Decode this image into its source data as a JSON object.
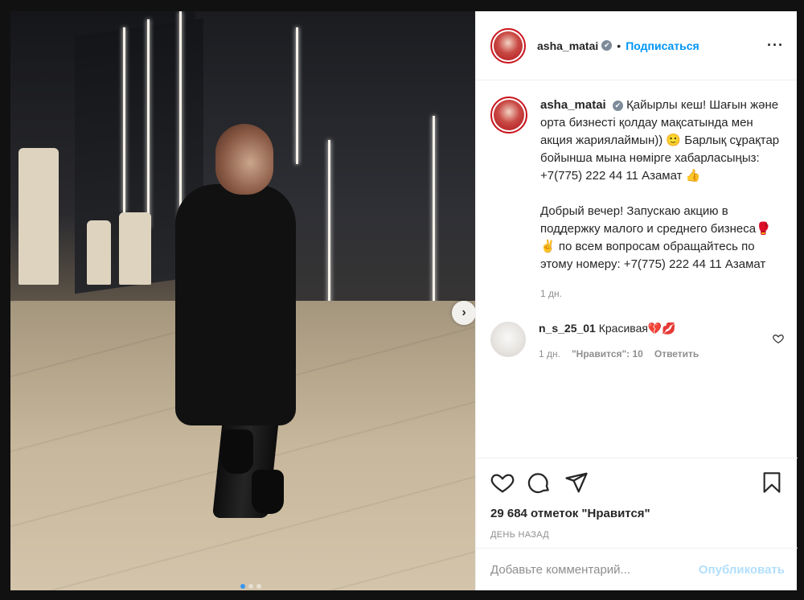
{
  "post": {
    "username": "asha_matai",
    "verified_glyph": "✔",
    "separator": "•",
    "follow_label": "Подписаться",
    "more_label": "···"
  },
  "caption": {
    "username": "asha_matai",
    "text": "Қайырлы кеш! Шағын және орта бизнесті қолдау мақсатында мен акция жариялаймын)) 🙂 Барлық сұрақтар бойынша мына нөмірге хабарласыңыз: +7(775) 222 44 11 Азамат 👍\n\nДобрый вечер! Запускаю акцию в поддержку малого и среднего бизнеса🥊✌️ по всем вопросам обращайтесь по этому номеру: +7(775) 222 44 11 Азамат",
    "time": "1 дн."
  },
  "comment": {
    "username": "n_s_25_01",
    "text": "Красивая💔💋",
    "time": "1 дн.",
    "likes": "\"Нравится\": 10",
    "reply_label": "Ответить",
    "heart_icon": "heart-outline-icon"
  },
  "actions": {
    "like_icon": "heart-icon",
    "comment_icon": "comment-icon",
    "share_icon": "share-icon",
    "save_icon": "bookmark-icon",
    "likes_text": "29 684 отметок \"Нравится\"",
    "date_text": "ДЕНЬ НАЗАД"
  },
  "add_comment": {
    "placeholder": "Добавьте комментарий...",
    "publish_label": "Опубликовать"
  },
  "carousel": {
    "next_glyph": "›",
    "slides_total": 3,
    "active_slide": 1
  },
  "colors": {
    "accent_blue": "#0095f6",
    "avatar_ring": "#c9151e",
    "publish_disabled": "#b2dffc"
  }
}
